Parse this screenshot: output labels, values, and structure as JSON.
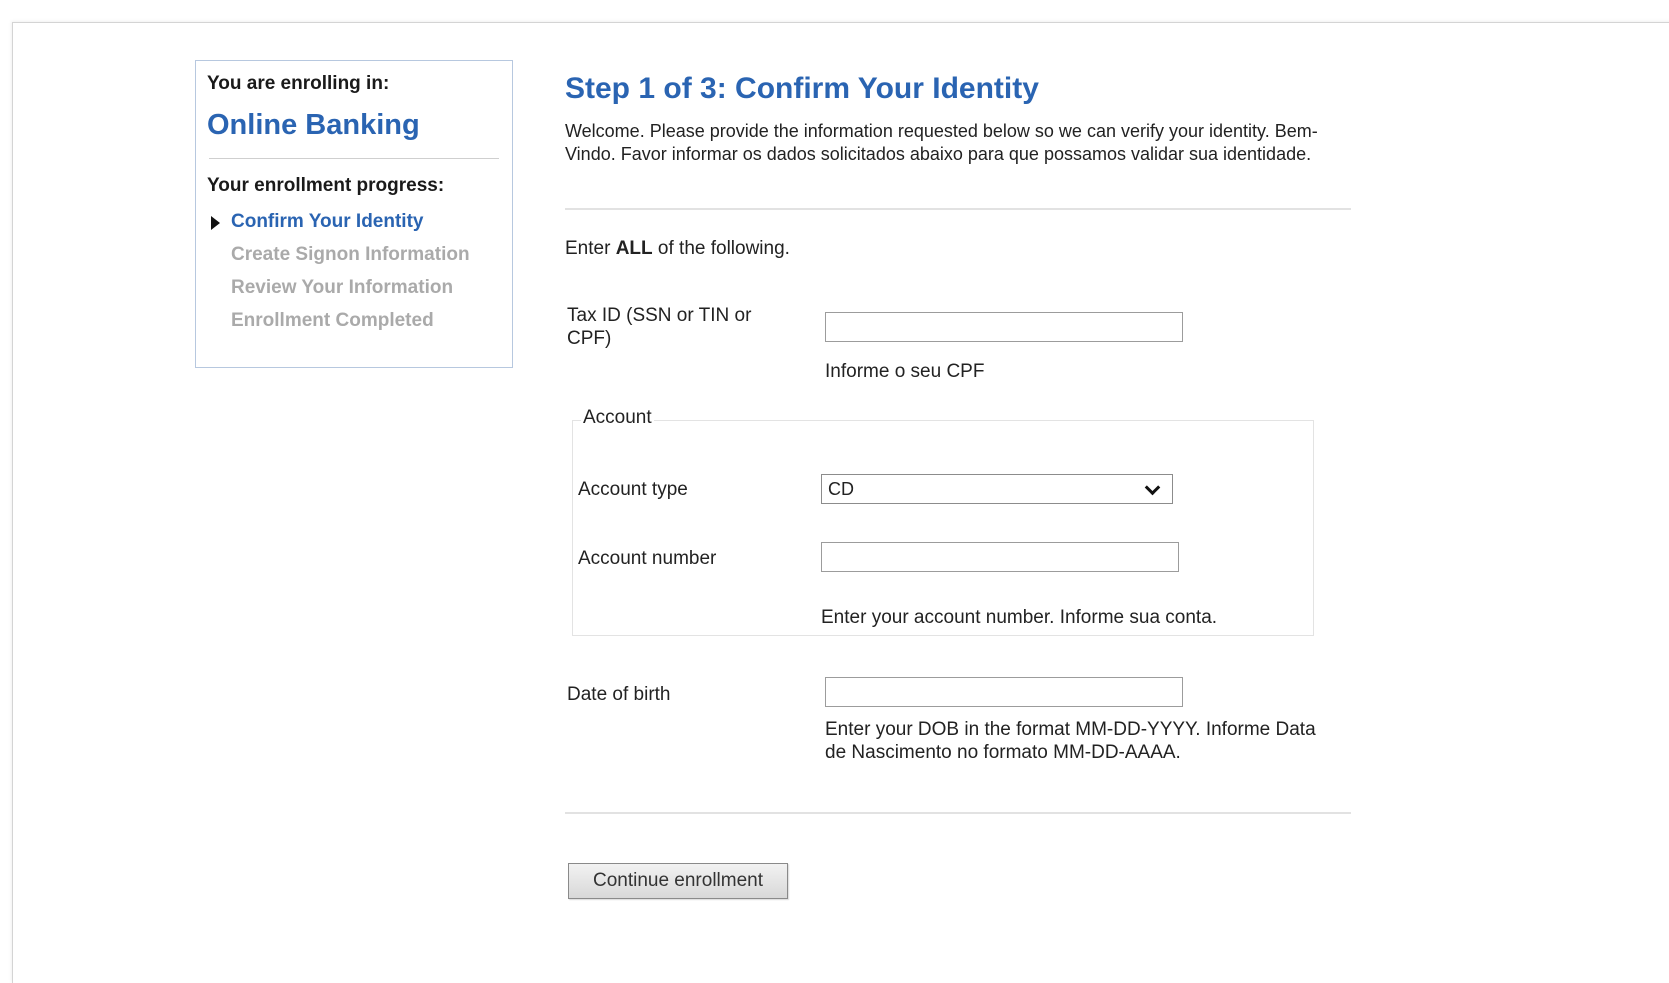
{
  "sidebar": {
    "enrolling_label": "You are enrolling in:",
    "product_name": "Online Banking",
    "progress_label": "Your enrollment progress:",
    "steps": [
      {
        "label": "Confirm Your Identity",
        "current": true
      },
      {
        "label": "Create Signon Information",
        "current": false
      },
      {
        "label": "Review Your Information",
        "current": false
      },
      {
        "label": "Enrollment Completed",
        "current": false
      }
    ]
  },
  "main": {
    "title": "Step 1 of 3: Confirm Your Identity",
    "intro": "Welcome. Please provide the information requested below so we can verify your identity. Bem-Vindo. Favor informar os dados solicitados abaixo para que possamos validar sua identidade.",
    "enter_all_prefix": "Enter ",
    "enter_all_bold": "ALL",
    "enter_all_suffix": " of the following.",
    "tax_id": {
      "label": "Tax ID (SSN or TIN or CPF)",
      "value": "",
      "help": "Informe o seu CPF"
    },
    "account": {
      "legend": "Account",
      "type_label": "Account type",
      "type_value": "CD",
      "number_label": "Account number",
      "number_value": "",
      "number_help": "Enter your account number. Informe sua conta."
    },
    "dob": {
      "label": "Date of birth",
      "value": "",
      "help": "Enter your DOB in the format MM-DD-YYYY. Informe Data de Nascimento no formato MM-DD-AAAA."
    },
    "continue_label": "Continue enrollment"
  },
  "colors": {
    "accent": "#2a64b2",
    "inactive_step": "#aaaaaa"
  }
}
